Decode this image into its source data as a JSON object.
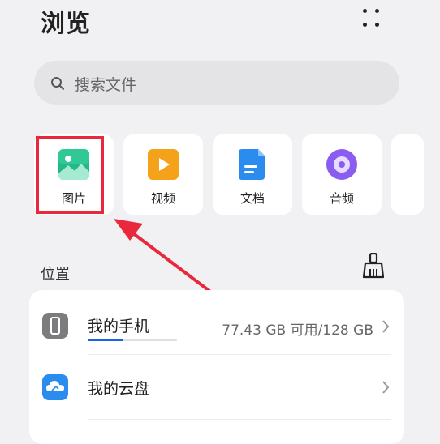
{
  "header": {
    "title": "浏览",
    "more_icon": "more-dots-icon"
  },
  "search": {
    "placeholder": "搜索文件",
    "icon": "search-icon"
  },
  "categories": [
    {
      "label": "图片",
      "icon": "image-icon",
      "color": "#2bbf8e"
    },
    {
      "label": "视频",
      "icon": "video-icon",
      "color": "#f5a21b"
    },
    {
      "label": "文档",
      "icon": "document-icon",
      "color": "#2b8cf0"
    },
    {
      "label": "音频",
      "icon": "audio-icon",
      "color": "#8a5cf0"
    }
  ],
  "locations": {
    "title": "位置",
    "clean_icon": "broom-icon",
    "items": [
      {
        "name": "我的手机",
        "detail": "77.43 GB 可用/128 GB",
        "icon": "phone-icon",
        "used_fraction": 0.4
      },
      {
        "name": "我的云盘",
        "detail": "",
        "icon": "cloud-icon"
      }
    ]
  },
  "colors": {
    "highlight": "#e8283c",
    "accent": "#1a63e6"
  }
}
